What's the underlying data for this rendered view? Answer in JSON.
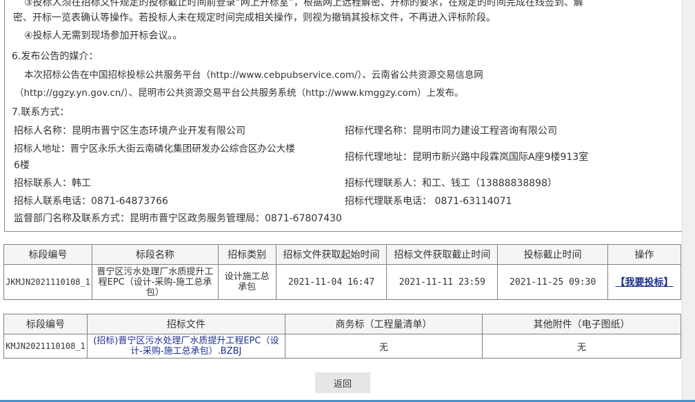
{
  "announcement": {
    "line1": "③投标人须在招标文件规定的投标截止时间前登录“网上开标室”，根据网上远程解密、开标的要求，在规定的时间完成在线签到、解",
    "line2": "密、开标一览表确认等操作。若投标人未在规定时间完成相关操作，则视为撤销其投标文件，不再进入评标阶段。",
    "line3": "④投标人无需到现场参加开标会议。。",
    "media_heading": "6.发布公告的媒介：",
    "media_line1": "本次招标公告在中国招标投标公共服务平台（http://www.cebpubservice.com/）、云南省公共资源交易信息网",
    "media_line2": "（http://ggzy.yn.gov.cn/）、昆明市公共资源交易平台公共服务系统（http://www.kmggzy.com）上发布。",
    "contact_heading": "7.联系方式：",
    "tenderer_name": "招标人名称：昆明市晋宁区生态环境产业开发有限公司",
    "agent_name": "招标代理名称：昆明市同力建设工程咨询有限公司",
    "tenderer_address_1": "招标人地址：晋宁区永乐大街云南磷化集团研发办公综合区办公大楼",
    "tenderer_address_2": "6楼",
    "agent_address": "招标代理地址：昆明市新兴路中段霖岚国际A座9楼913室",
    "tenderer_contact": "招标联系人：韩工",
    "agent_contact": "招标代理联系人：和工、钱工（13888838898）",
    "tenderer_phone": "招标人联系电话：0871-64873766",
    "agent_phone": "招标代理联系电话： 0871-63114071",
    "supervisor": "监督部门名称及联系方式：昆明市晋宁区政务服务管理局：0871-67807430"
  },
  "section_table": {
    "headers": [
      "标段编号",
      "标段名称",
      "招标类别",
      "招标文件获取起始时间",
      "招标文件获取截止时间",
      "投标截止时间",
      "操作"
    ],
    "row": {
      "code": "JKMJN2021110108_1",
      "name": "晋宁区污水处理厂水质提升工程EPC（设计-采购-施工总承包）",
      "category": "设计施工总承包",
      "start_time": "2021-11-04 16:47",
      "end_time": "2021-11-11 23:59",
      "bid_deadline": "2021-11-25 09:30",
      "action": "【我要投标】"
    }
  },
  "file_table": {
    "headers": [
      "标段编号",
      "招标文件",
      "商务标（工程量清单）",
      "其他附件（电子图纸）"
    ],
    "row": {
      "code": "KMJN2021110108_1",
      "file": "(招标)晋宁区污水处理厂水质提升工程EPC（设计-采购-施工总承包）.BZBJ",
      "business": "无",
      "other": "无"
    }
  },
  "buttons": {
    "return": "返回"
  },
  "colors": {
    "link": "#1c2f8e",
    "border": "#7f7f7f",
    "accent_bar": "#4a90c8"
  }
}
